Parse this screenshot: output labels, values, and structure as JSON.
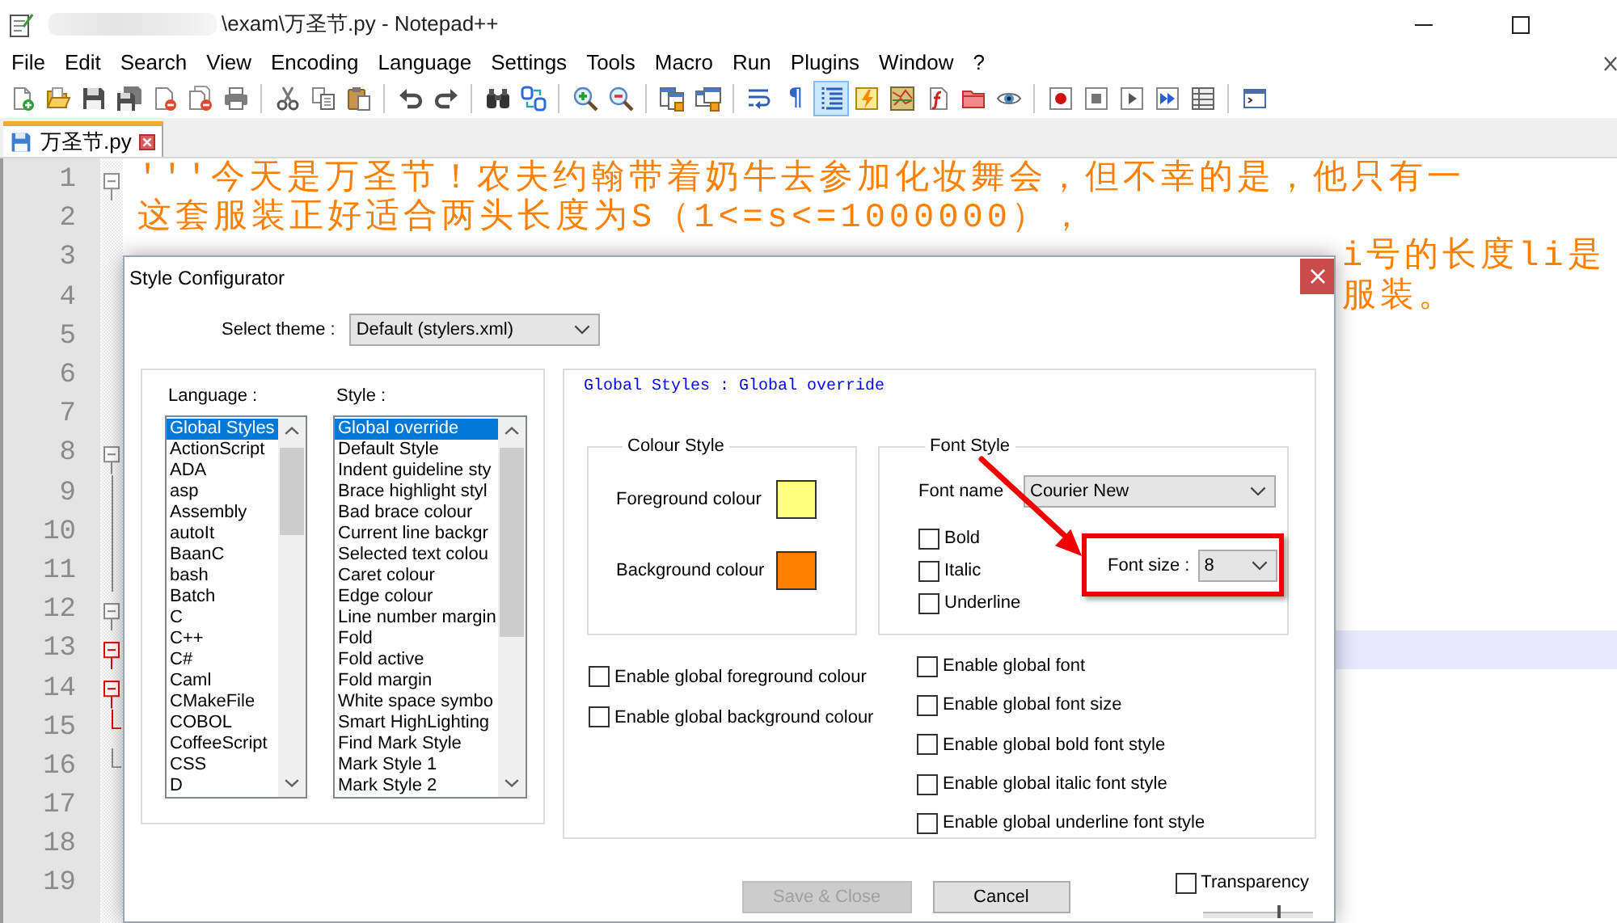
{
  "window": {
    "title": "\\exam\\万圣节.py - Notepad++"
  },
  "menu": [
    "File",
    "Edit",
    "Search",
    "View",
    "Encoding",
    "Language",
    "Settings",
    "Tools",
    "Macro",
    "Run",
    "Plugins",
    "Window",
    "?"
  ],
  "toolbar": {
    "groups": [
      {
        "buttons": [
          {
            "kind": "new",
            "pressed": false
          },
          {
            "kind": "open",
            "pressed": false
          },
          {
            "kind": "save",
            "pressed": false
          },
          {
            "kind": "save-all",
            "pressed": false
          },
          {
            "kind": "close",
            "pressed": false
          },
          {
            "kind": "close-all",
            "pressed": false
          },
          {
            "kind": "print",
            "pressed": false
          }
        ]
      },
      {
        "buttons": [
          {
            "kind": "cut",
            "pressed": false
          },
          {
            "kind": "copy",
            "pressed": false
          },
          {
            "kind": "paste",
            "pressed": false
          }
        ]
      },
      {
        "buttons": [
          {
            "kind": "undo",
            "pressed": false
          },
          {
            "kind": "redo",
            "pressed": false
          }
        ]
      },
      {
        "buttons": [
          {
            "kind": "find",
            "pressed": false
          },
          {
            "kind": "replace",
            "pressed": false
          }
        ]
      },
      {
        "buttons": [
          {
            "kind": "zoom-in",
            "pressed": false
          },
          {
            "kind": "zoom-out",
            "pressed": false
          }
        ]
      },
      {
        "buttons": [
          {
            "kind": "sync-v",
            "pressed": false
          },
          {
            "kind": "sync-h",
            "pressed": false
          }
        ]
      },
      {
        "buttons": [
          {
            "kind": "wrap",
            "pressed": false
          },
          {
            "kind": "glyph",
            "text": "¶",
            "pressed": false
          },
          {
            "kind": "indent-guide",
            "pressed": true
          },
          {
            "kind": "udl",
            "pressed": false
          },
          {
            "kind": "doc-map",
            "pressed": false
          },
          {
            "kind": "func-list",
            "pressed": false
          },
          {
            "kind": "folder",
            "pressed": false
          },
          {
            "kind": "eye",
            "pressed": false
          }
        ]
      },
      {
        "buttons": [
          {
            "kind": "record",
            "pressed": false
          },
          {
            "kind": "stop",
            "pressed": false
          },
          {
            "kind": "play",
            "pressed": false
          },
          {
            "kind": "play-multi",
            "pressed": false
          },
          {
            "kind": "save-macro",
            "pressed": false
          }
        ]
      },
      {
        "buttons": [
          {
            "kind": "console",
            "pressed": false
          }
        ]
      }
    ]
  },
  "tabs": [
    {
      "label": "万圣节.py",
      "selected": true
    }
  ],
  "editor": {
    "lines": [
      {
        "number": "1",
        "kind": "full",
        "text": "'''今天是万圣节！农夫约翰带着奶牛去参加化妆舞会，但不幸的是，他只有一",
        "fold": {
          "kind": "start",
          "active": false
        },
        "current": false
      },
      {
        "number": "2",
        "kind": "full",
        "text": "这套服装正好适合两头长度为S（1<=s<=1000000），",
        "current": false
      },
      {
        "number": "3",
        "kind": "tail",
        "text": "i号的长度li是",
        "current": false
      },
      {
        "number": "4",
        "kind": "tail",
        "text": "服装。",
        "current": false
      },
      {
        "number": "5",
        "kind": "covered",
        "current": false
      },
      {
        "number": "6",
        "kind": "covered",
        "current": false
      },
      {
        "number": "7",
        "kind": "covered",
        "current": false
      },
      {
        "number": "8",
        "kind": "covered",
        "fold": {
          "kind": "start",
          "active": false
        },
        "current": false
      },
      {
        "number": "9",
        "kind": "covered",
        "fold": {
          "kind": "line",
          "active": false
        },
        "current": false
      },
      {
        "number": "10",
        "kind": "covered",
        "fold": {
          "kind": "line",
          "active": false
        },
        "current": false
      },
      {
        "number": "11",
        "kind": "covered",
        "fold": {
          "kind": "line",
          "active": false
        },
        "current": false
      },
      {
        "number": "12",
        "kind": "covered",
        "fold": {
          "kind": "start",
          "active": false
        },
        "current": false
      },
      {
        "number": "13",
        "kind": "covered",
        "fold": {
          "kind": "start",
          "active": true
        },
        "current": true
      },
      {
        "number": "14",
        "kind": "covered",
        "fold": {
          "kind": "start",
          "active": true
        },
        "current": false
      },
      {
        "number": "15",
        "kind": "covered",
        "fold": {
          "kind": "end",
          "active": true
        },
        "current": false
      },
      {
        "number": "16",
        "kind": "covered",
        "fold": {
          "kind": "end",
          "active": false
        },
        "current": false
      },
      {
        "number": "17",
        "kind": "covered",
        "current": false
      },
      {
        "number": "18",
        "kind": "covered",
        "current": false
      },
      {
        "number": "19",
        "kind": "covered",
        "current": false
      }
    ]
  },
  "dialog": {
    "title": "Style Configurator",
    "theme": {
      "label": "Select theme :",
      "value": "Default (stylers.xml)"
    },
    "language_list": {
      "label": "Language :",
      "items": [
        {
          "text": "Global Styles",
          "selected": true
        },
        {
          "text": "ActionScript",
          "selected": false
        },
        {
          "text": "ADA",
          "selected": false
        },
        {
          "text": "asp",
          "selected": false
        },
        {
          "text": "Assembly",
          "selected": false
        },
        {
          "text": "autoIt",
          "selected": false
        },
        {
          "text": "BaanC",
          "selected": false
        },
        {
          "text": "bash",
          "selected": false
        },
        {
          "text": "Batch",
          "selected": false
        },
        {
          "text": "C",
          "selected": false
        },
        {
          "text": "C++",
          "selected": false
        },
        {
          "text": "C#",
          "selected": false
        },
        {
          "text": "Caml",
          "selected": false
        },
        {
          "text": "CMakeFile",
          "selected": false
        },
        {
          "text": "COBOL",
          "selected": false
        },
        {
          "text": "CoffeeScript",
          "selected": false
        },
        {
          "text": "CSS",
          "selected": false
        },
        {
          "text": "D",
          "selected": false
        }
      ]
    },
    "style_list": {
      "label": "Style :",
      "items": [
        {
          "text": "Global override",
          "selected": true
        },
        {
          "text": "Default Style",
          "selected": false
        },
        {
          "text": "Indent guideline sty",
          "selected": false
        },
        {
          "text": "Brace highlight styl",
          "selected": false
        },
        {
          "text": "Bad brace colour",
          "selected": false
        },
        {
          "text": "Current line backgr",
          "selected": false
        },
        {
          "text": "Selected text colou",
          "selected": false
        },
        {
          "text": "Caret colour",
          "selected": false
        },
        {
          "text": "Edge colour",
          "selected": false
        },
        {
          "text": "Line number margin",
          "selected": false
        },
        {
          "text": "Fold",
          "selected": false
        },
        {
          "text": "Fold active",
          "selected": false
        },
        {
          "text": "Fold margin",
          "selected": false
        },
        {
          "text": "White space symbo",
          "selected": false
        },
        {
          "text": "Smart HighLighting",
          "selected": false
        },
        {
          "text": "Find Mark Style",
          "selected": false
        },
        {
          "text": "Mark Style 1",
          "selected": false
        },
        {
          "text": "Mark Style 2",
          "selected": false
        }
      ]
    },
    "heading": "Global Styles : Global override",
    "colour_style": {
      "title": "Colour Style",
      "swatches": [
        {
          "label": "Foreground colour",
          "color": "#ffff80"
        },
        {
          "label": "Background colour",
          "color": "#ff8000"
        }
      ]
    },
    "font_style": {
      "title": "Font Style",
      "font_name": {
        "label": "Font name",
        "value": "Courier New"
      },
      "checkboxes": [
        {
          "label": "Bold",
          "checked": false
        },
        {
          "label": "Italic",
          "checked": false
        },
        {
          "label": "Underline",
          "checked": false
        }
      ],
      "font_size": {
        "label": "Font size :",
        "value": "8",
        "highlighted": true
      }
    },
    "global_options_left": [
      {
        "label": "Enable global foreground colour",
        "checked": false
      },
      {
        "label": "Enable global background colour",
        "checked": false
      }
    ],
    "global_options_right": [
      {
        "label": "Enable global font",
        "checked": false
      },
      {
        "label": "Enable global font size",
        "checked": false
      },
      {
        "label": "Enable global bold font style",
        "checked": false
      },
      {
        "label": "Enable global italic font style",
        "checked": false
      },
      {
        "label": "Enable global underline font style",
        "checked": false
      }
    ],
    "buttons": [
      {
        "label": "Save & Close",
        "disabled": true
      },
      {
        "label": "Cancel",
        "disabled": false
      }
    ],
    "transparency": {
      "label": "Transparency",
      "checked": false,
      "level": 0.7
    }
  }
}
